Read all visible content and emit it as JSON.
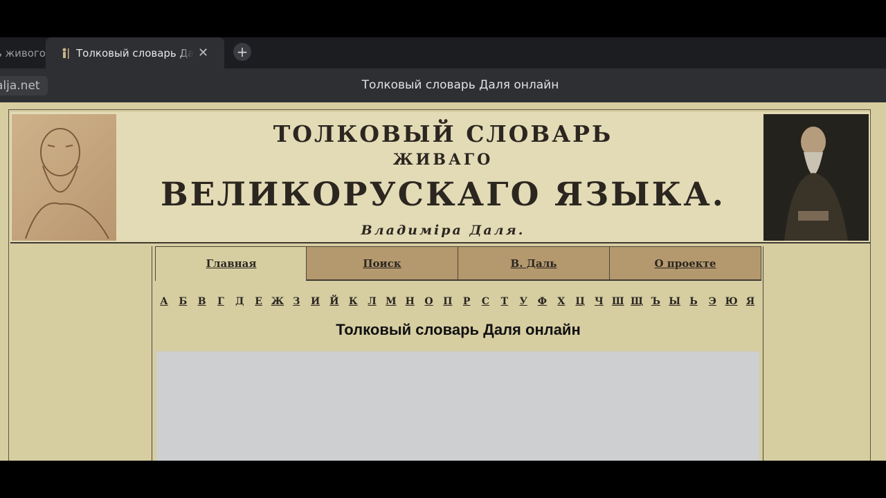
{
  "browser": {
    "prev_tab_title": "ь живого",
    "active_tab_title": "Толковый словарь Даля онлайн",
    "close_symbol": "✕",
    "new_tab_symbol": "+",
    "url_chip": "alja.net",
    "page_caption": "Толковый словарь Даля онлайн"
  },
  "banner": {
    "line1": "ТОЛКОВЫЙ СЛОВАРЬ",
    "line2": "ЖИВАГО",
    "line3": "ВЕЛИКОРУСКАГО ЯЗЫКА.",
    "line4": "Владиміра Даля."
  },
  "nav": {
    "tabs": [
      {
        "label": "Главная",
        "active": true
      },
      {
        "label": "Поиск",
        "active": false
      },
      {
        "label": "В. Даль",
        "active": false
      },
      {
        "label": "О проекте",
        "active": false
      }
    ]
  },
  "alphabet": [
    "А",
    "Б",
    "В",
    "Г",
    "Д",
    "Е",
    "Ж",
    "З",
    "И",
    "Й",
    "К",
    "Л",
    "М",
    "Н",
    "О",
    "П",
    "Р",
    "С",
    "Т",
    "У",
    "Ф",
    "Х",
    "Ц",
    "Ч",
    "Ш",
    "Щ",
    "Ъ",
    "Ы",
    "Ь",
    "Э",
    "Ю",
    "Я"
  ],
  "main": {
    "heading": "Толковый словарь Даля онлайн"
  },
  "colors": {
    "page_bg": "#d6cda1",
    "tab_inactive_bg": "#b4986e",
    "chrome_bg": "#2e2f33"
  }
}
